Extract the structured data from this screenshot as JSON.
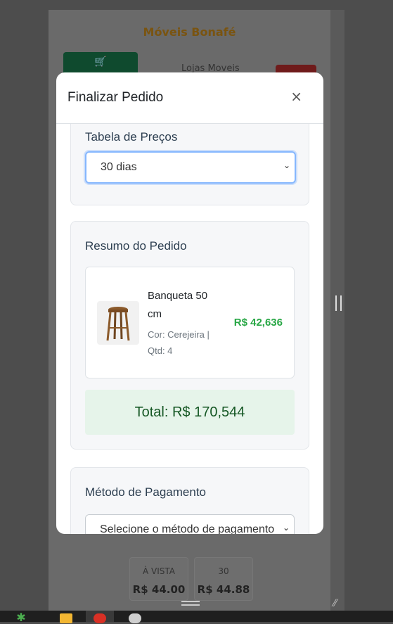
{
  "background_page": {
    "title": "Móveis Bonafé",
    "cart_icon": "cart-icon",
    "stores_label": "Lojas Moveis",
    "price_boxes": [
      {
        "label": "À VISTA",
        "value": "R$ 44.00"
      },
      {
        "label": "30",
        "value": "R$ 44.88"
      }
    ]
  },
  "modal": {
    "title": "Finalizar Pedido",
    "close_label": "×",
    "price_table": {
      "title": "Tabela de Preços",
      "selected": "30 dias"
    },
    "summary": {
      "title": "Resumo do Pedido",
      "items": [
        {
          "name": "Banqueta 50 cm",
          "meta": "Cor: Cerejeira | Qtd: 4",
          "price": "R$ 42,636"
        }
      ],
      "total": "Total: R$ 170,544"
    },
    "payment": {
      "title": "Método de Pagamento",
      "placeholder": "Selecione o método de pagamento"
    }
  },
  "taskbar": {
    "icons": [
      "app-icon",
      "folder-icon",
      "chrome-icon",
      "app-icon-2"
    ]
  },
  "colors": {
    "accent_green": "#28a745",
    "total_bg": "#e6f4ea",
    "focus_border": "#86b7fe"
  }
}
